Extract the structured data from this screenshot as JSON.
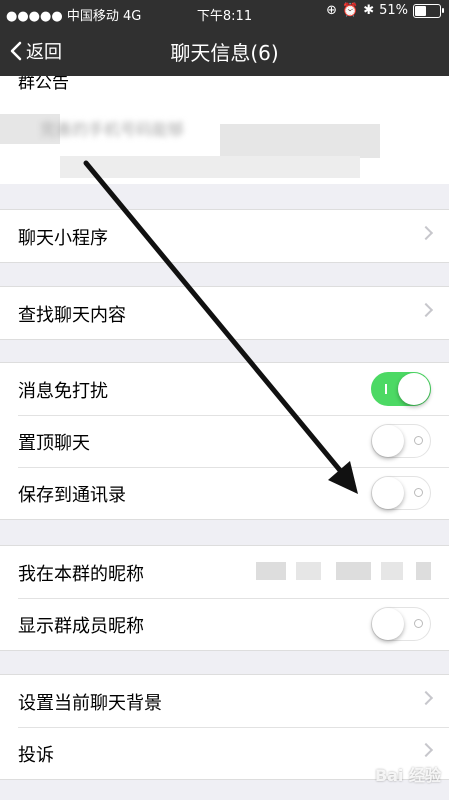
{
  "status_bar": {
    "carrier": "中国移动",
    "network": "4G",
    "time": "下午8:11",
    "battery": "51%",
    "battery_level": 0.51
  },
  "nav": {
    "back_label": "返回",
    "title": "聊天信息(6)"
  },
  "announcement": {
    "label": "群公告",
    "content": "完善的手机号码能够"
  },
  "rows": {
    "mini_program": "聊天小程序",
    "search_chat": "查找聊天内容",
    "mute": "消息免打扰",
    "pin": "置顶聊天",
    "save_contacts": "保存到通讯录",
    "my_nickname": "我在本群的昵称",
    "show_member_names": "显示群成员昵称",
    "set_background": "设置当前聊天背景",
    "report": "投诉"
  },
  "toggles": {
    "mute": true,
    "pin": false,
    "save_contacts": false,
    "show_member_names": false
  },
  "watermark": "Bai 经验",
  "colors": {
    "nav_bg": "#303030",
    "toggle_on": "#4cd964",
    "page_bg": "#efeff4"
  }
}
